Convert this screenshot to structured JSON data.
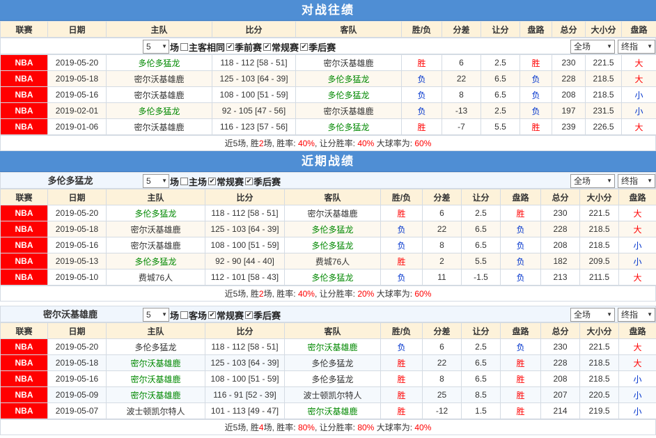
{
  "h2h": {
    "title": "对战往绩",
    "headers": [
      "联赛",
      "日期",
      "主队",
      "比分",
      "客队",
      "胜/负",
      "分差",
      "让分",
      "盘路",
      "总分",
      "大小分",
      "盘路"
    ],
    "controls": {
      "count": "5",
      "count_suffix": "场",
      "opts": [
        "主客相同",
        "季前赛",
        "常规赛",
        "季后赛"
      ],
      "checked": [
        false,
        true,
        true,
        true
      ],
      "scope": "全场",
      "line": "终指"
    },
    "rows": [
      {
        "league": "NBA",
        "date": "2019-05-20",
        "home": "多伦多猛龙",
        "home_hl": true,
        "score": "118 - 112 [58 - 51]",
        "away": "密尔沃基雄鹿",
        "away_hl": false,
        "wl": "胜",
        "diff": "6",
        "handicap": "2.5",
        "pan": "胜",
        "total": "230",
        "ou_line": "221.5",
        "ou": "大"
      },
      {
        "league": "NBA",
        "date": "2019-05-18",
        "home": "密尔沃基雄鹿",
        "home_hl": false,
        "score": "125 - 103 [64 - 39]",
        "away": "多伦多猛龙",
        "away_hl": true,
        "wl": "负",
        "diff": "22",
        "handicap": "6.5",
        "pan": "负",
        "total": "228",
        "ou_line": "218.5",
        "ou": "大"
      },
      {
        "league": "NBA",
        "date": "2019-05-16",
        "home": "密尔沃基雄鹿",
        "home_hl": false,
        "score": "108 - 100 [51 - 59]",
        "away": "多伦多猛龙",
        "away_hl": true,
        "wl": "负",
        "diff": "8",
        "handicap": "6.5",
        "pan": "负",
        "total": "208",
        "ou_line": "218.5",
        "ou": "小"
      },
      {
        "league": "NBA",
        "date": "2019-02-01",
        "home": "多伦多猛龙",
        "home_hl": true,
        "score": "92 - 105 [47 - 56]",
        "away": "密尔沃基雄鹿",
        "away_hl": false,
        "wl": "负",
        "diff": "-13",
        "handicap": "2.5",
        "pan": "负",
        "total": "197",
        "ou_line": "231.5",
        "ou": "小"
      },
      {
        "league": "NBA",
        "date": "2019-01-06",
        "home": "密尔沃基雄鹿",
        "home_hl": false,
        "score": "116 - 123 [57 - 56]",
        "away": "多伦多猛龙",
        "away_hl": true,
        "wl": "胜",
        "diff": "-7",
        "handicap": "5.5",
        "pan": "胜",
        "total": "239",
        "ou_line": "226.5",
        "ou": "大"
      }
    ],
    "summary": {
      "p1": "近5场, 胜",
      "wins": "2",
      "p2": "场, 胜率: ",
      "win_rate": "40%",
      "p3": ", 让分胜率: ",
      "ats_rate": "40%",
      "p4": " 大球率为: ",
      "over_rate": "60%"
    }
  },
  "recent": {
    "title": "近期战绩",
    "teamA": {
      "name": "多伦多猛龙",
      "controls": {
        "count": "5",
        "count_suffix": "场",
        "opts": [
          "主场",
          "常规赛",
          "季后赛"
        ],
        "checked": [
          false,
          true,
          true
        ],
        "scope": "全场",
        "line": "终指"
      },
      "headers": [
        "联赛",
        "日期",
        "主队",
        "比分",
        "客队",
        "胜/负",
        "分差",
        "让分",
        "盘路",
        "总分",
        "大小分",
        "盘路"
      ],
      "rows": [
        {
          "league": "NBA",
          "date": "2019-05-20",
          "home": "多伦多猛龙",
          "home_hl": true,
          "score": "118 - 112 [58 - 51]",
          "away": "密尔沃基雄鹿",
          "away_hl": false,
          "wl": "胜",
          "diff": "6",
          "handicap": "2.5",
          "pan": "胜",
          "total": "230",
          "ou_line": "221.5",
          "ou": "大"
        },
        {
          "league": "NBA",
          "date": "2019-05-18",
          "home": "密尔沃基雄鹿",
          "home_hl": false,
          "score": "125 - 103 [64 - 39]",
          "away": "多伦多猛龙",
          "away_hl": true,
          "wl": "负",
          "diff": "22",
          "handicap": "6.5",
          "pan": "负",
          "total": "228",
          "ou_line": "218.5",
          "ou": "大"
        },
        {
          "league": "NBA",
          "date": "2019-05-16",
          "home": "密尔沃基雄鹿",
          "home_hl": false,
          "score": "108 - 100 [51 - 59]",
          "away": "多伦多猛龙",
          "away_hl": true,
          "wl": "负",
          "diff": "8",
          "handicap": "6.5",
          "pan": "负",
          "total": "208",
          "ou_line": "218.5",
          "ou": "小"
        },
        {
          "league": "NBA",
          "date": "2019-05-13",
          "home": "多伦多猛龙",
          "home_hl": true,
          "score": "92 - 90 [44 - 40]",
          "away": "费城76人",
          "away_hl": false,
          "wl": "胜",
          "diff": "2",
          "handicap": "5.5",
          "pan": "负",
          "total": "182",
          "ou_line": "209.5",
          "ou": "小"
        },
        {
          "league": "NBA",
          "date": "2019-05-10",
          "home": "费城76人",
          "home_hl": false,
          "score": "112 - 101 [58 - 43]",
          "away": "多伦多猛龙",
          "away_hl": true,
          "wl": "负",
          "diff": "11",
          "handicap": "-1.5",
          "pan": "负",
          "total": "213",
          "ou_line": "211.5",
          "ou": "大"
        }
      ],
      "summary": {
        "p1": "近5场, 胜",
        "wins": "2",
        "p2": "场, 胜率: ",
        "win_rate": "40%",
        "p3": ", 让分胜率: ",
        "ats_rate": "20%",
        "p4": " 大球率为: ",
        "over_rate": "60%"
      }
    },
    "teamB": {
      "name": "密尔沃基雄鹿",
      "controls": {
        "count": "5",
        "count_suffix": "场",
        "opts": [
          "客场",
          "常规赛",
          "季后赛"
        ],
        "checked": [
          false,
          true,
          true
        ],
        "scope": "全场",
        "line": "终指"
      },
      "headers": [
        "联赛",
        "日期",
        "主队",
        "比分",
        "客队",
        "胜/负",
        "分差",
        "让分",
        "盘路",
        "总分",
        "大小分",
        "盘路"
      ],
      "rows": [
        {
          "league": "NBA",
          "date": "2019-05-20",
          "home": "多伦多猛龙",
          "home_hl": false,
          "score": "118 - 112 [58 - 51]",
          "away": "密尔沃基雄鹿",
          "away_hl": true,
          "wl": "负",
          "diff": "6",
          "handicap": "2.5",
          "pan": "负",
          "total": "230",
          "ou_line": "221.5",
          "ou": "大"
        },
        {
          "league": "NBA",
          "date": "2019-05-18",
          "home": "密尔沃基雄鹿",
          "home_hl": true,
          "score": "125 - 103 [64 - 39]",
          "away": "多伦多猛龙",
          "away_hl": false,
          "wl": "胜",
          "diff": "22",
          "handicap": "6.5",
          "pan": "胜",
          "total": "228",
          "ou_line": "218.5",
          "ou": "大"
        },
        {
          "league": "NBA",
          "date": "2019-05-16",
          "home": "密尔沃基雄鹿",
          "home_hl": true,
          "score": "108 - 100 [51 - 59]",
          "away": "多伦多猛龙",
          "away_hl": false,
          "wl": "胜",
          "diff": "8",
          "handicap": "6.5",
          "pan": "胜",
          "total": "208",
          "ou_line": "218.5",
          "ou": "小"
        },
        {
          "league": "NBA",
          "date": "2019-05-09",
          "home": "密尔沃基雄鹿",
          "home_hl": true,
          "score": "116 - 91 [52 - 39]",
          "away": "波士顿凯尔特人",
          "away_hl": false,
          "wl": "胜",
          "diff": "25",
          "handicap": "8.5",
          "pan": "胜",
          "total": "207",
          "ou_line": "220.5",
          "ou": "小"
        },
        {
          "league": "NBA",
          "date": "2019-05-07",
          "home": "波士顿凯尔特人",
          "home_hl": false,
          "score": "101 - 113 [49 - 47]",
          "away": "密尔沃基雄鹿",
          "away_hl": true,
          "wl": "胜",
          "diff": "-12",
          "handicap": "1.5",
          "pan": "胜",
          "total": "214",
          "ou_line": "219.5",
          "ou": "小"
        }
      ],
      "summary": {
        "p1": "近5场, 胜",
        "wins": "4",
        "p2": "场, 胜率: ",
        "win_rate": "80%",
        "p3": ", 让分胜率: ",
        "ats_rate": "80%",
        "p4": " 大球率为: ",
        "over_rate": "40%"
      }
    }
  },
  "colors": {
    "header_bar": "#4f8ed4",
    "league_bg": "#ff0000",
    "win": "#ff0000",
    "lose": "#0033cc",
    "team_highlight": "#008800",
    "th_bg": "#fdf2da"
  }
}
